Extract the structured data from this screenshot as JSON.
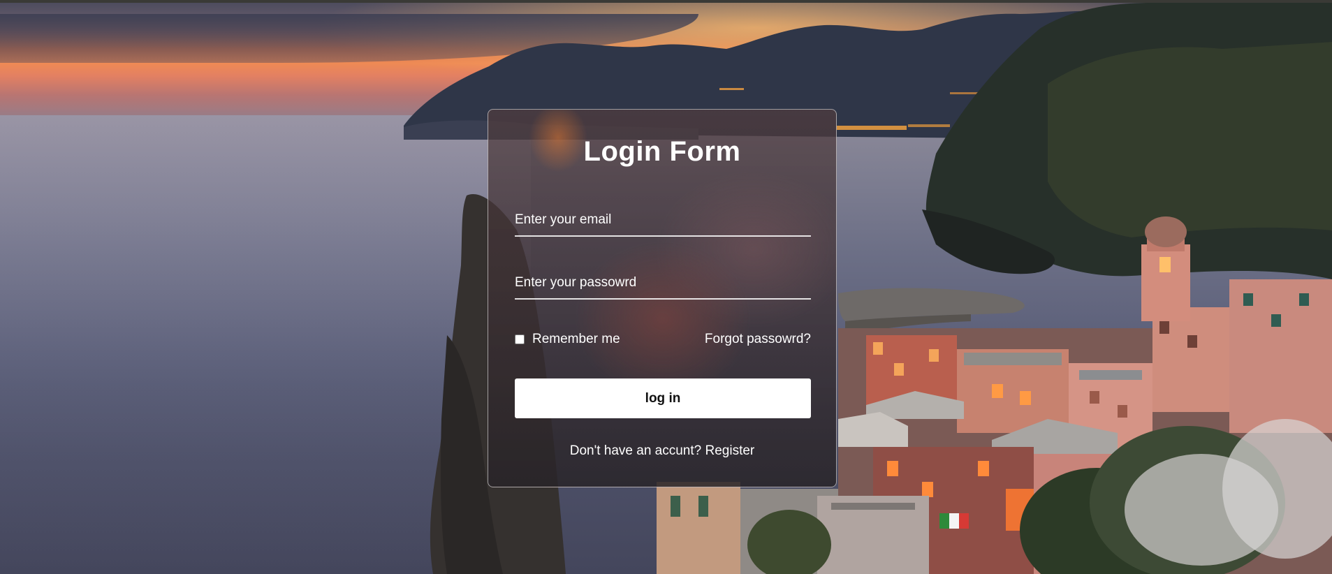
{
  "login_form": {
    "title": "Login Form",
    "email": {
      "placeholder": "Enter your email",
      "value": ""
    },
    "password": {
      "placeholder": "Enter your passowrd",
      "value": ""
    },
    "remember_me": {
      "label": "Remember me",
      "checked": false
    },
    "forgot_password_label": "Forgot passowrd?",
    "login_button_label": "log in",
    "register_prompt": "Don't have an accunt?",
    "register_link_label": "Register"
  },
  "theme": {
    "card_border": "#ffffff",
    "button_background": "#ffffff",
    "button_text": "#111111",
    "text": "#ffffff"
  }
}
